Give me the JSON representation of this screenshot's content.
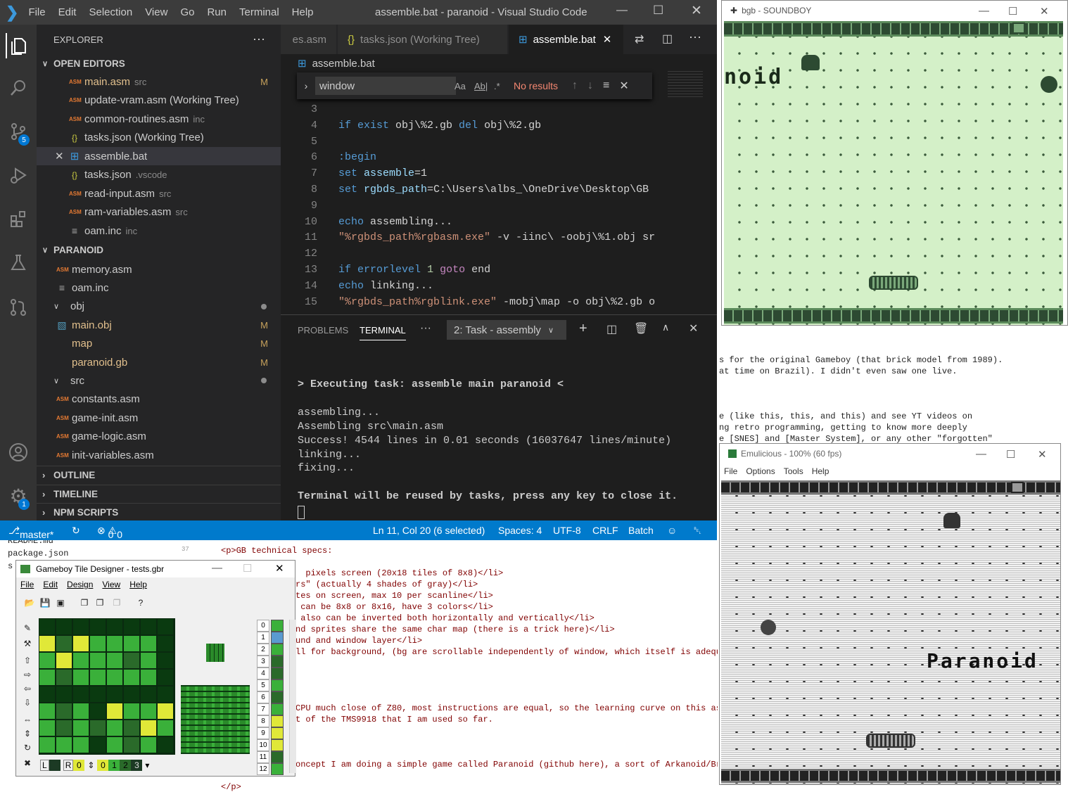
{
  "vscode": {
    "window_title": "assemble.bat - paranoid - Visual Studio Code",
    "menu": [
      "File",
      "Edit",
      "Selection",
      "View",
      "Go",
      "Run",
      "Terminal",
      "Help"
    ],
    "activity_badges": {
      "scm": "5",
      "settings": "1"
    },
    "explorer_title": "EXPLORER",
    "open_editors_label": "OPEN EDITORS",
    "open_editors": [
      {
        "name": "main.asm",
        "desc": "src",
        "flag": "M"
      },
      {
        "name": "update-vram.asm (Working Tree)",
        "desc": "",
        "flag": ""
      },
      {
        "name": "common-routines.asm",
        "desc": "inc",
        "flag": ""
      },
      {
        "name": "tasks.json (Working Tree)",
        "desc": "",
        "flag": ""
      },
      {
        "name": "assemble.bat",
        "desc": "",
        "flag": ""
      },
      {
        "name": "tasks.json",
        "desc": ".vscode",
        "flag": ""
      },
      {
        "name": "read-input.asm",
        "desc": "src",
        "flag": ""
      },
      {
        "name": "ram-variables.asm",
        "desc": "src",
        "flag": ""
      },
      {
        "name": "oam.inc",
        "desc": "inc",
        "flag": ""
      }
    ],
    "project_label": "PARANOID",
    "tree": [
      {
        "name": "memory.asm",
        "flag": ""
      },
      {
        "name": "oam.inc",
        "flag": ""
      },
      {
        "name": "obj",
        "flag": ""
      },
      {
        "name": "main.obj",
        "flag": "M"
      },
      {
        "name": "map",
        "flag": "M"
      },
      {
        "name": "paranoid.gb",
        "flag": "M"
      },
      {
        "name": "src",
        "flag": ""
      },
      {
        "name": "constants.asm",
        "flag": ""
      },
      {
        "name": "game-init.asm",
        "flag": ""
      },
      {
        "name": "game-logic.asm",
        "flag": ""
      },
      {
        "name": "init-variables.asm",
        "flag": ""
      }
    ],
    "outline_label": "OUTLINE",
    "timeline_label": "TIMELINE",
    "npm_label": "NPM SCRIPTS",
    "tabs": [
      "es.asm",
      "tasks.json (Working Tree)",
      "assemble.bat"
    ],
    "breadcrumb": "assemble.bat",
    "find": {
      "value": "window",
      "aa": "Aa",
      "ab": "Ab|",
      "re": ".*",
      "result": "No results"
    },
    "code_lines": [
      {
        "n": "3",
        "t": ""
      },
      {
        "n": "4",
        "t": "if exist obj\\%2.gb del obj\\%2.gb"
      },
      {
        "n": "5",
        "t": ""
      },
      {
        "n": "6",
        "t": ":begin"
      },
      {
        "n": "7",
        "t": "set assemble=1"
      },
      {
        "n": "8",
        "t": "set rgbds_path=C:\\Users\\albs_\\OneDrive\\Desktop\\GB"
      },
      {
        "n": "9",
        "t": ""
      },
      {
        "n": "10",
        "t": "echo assembling..."
      },
      {
        "n": "11",
        "t": "\"%rgbds_path%rgbasm.exe\" -v -iinc\\ -oobj\\%1.obj sr"
      },
      {
        "n": "12",
        "t": ""
      },
      {
        "n": "13",
        "t": "if errorlevel 1 goto end"
      },
      {
        "n": "14",
        "t": "echo linking..."
      },
      {
        "n": "15",
        "t": "\"%rgbds_path%rgblink.exe\" -mobj\\map -o obj\\%2.gb o"
      }
    ],
    "panel_tabs": [
      "PROBLEMS",
      "TERMINAL",
      "···"
    ],
    "task_select": "2: Task - assembly",
    "terminal_lines": [
      "> Executing task: assemble main paranoid <",
      "",
      "assembling...",
      "Assembling src\\main.asm",
      "Success! 4544 lines in 0.01 seconds (16037647 lines/minute)",
      "linking...",
      "fixing...",
      "",
      "Terminal will be reused by tasks, press any key to close it."
    ],
    "status": {
      "branch": "master*",
      "errors": "0",
      "warnings": "0",
      "position": "Ln 11, Col 20 (6 selected)",
      "spaces": "Spaces: 4",
      "encoding": "UTF-8",
      "eol": "CRLF",
      "lang": "Batch"
    }
  },
  "bgb": {
    "title": "bgb - SOUNDBOY",
    "game_text": "noid"
  },
  "emulicious": {
    "title": "Emulicious - 100% (60 fps)",
    "menu": [
      "File",
      "Options",
      "Tools",
      "Help"
    ],
    "game_text": "Paranoid"
  },
  "gbtd": {
    "title": "Gameboy Tile Designer - tests.gbr",
    "menu": [
      "File",
      "Edit",
      "Design",
      "View",
      "Help"
    ],
    "l_label": "L",
    "r_label": "R",
    "r_value": "0",
    "palette": [
      "0",
      "1",
      "2",
      "3"
    ],
    "tile_numbers": [
      "0",
      "1",
      "2",
      "3",
      "4",
      "5",
      "6",
      "7",
      "8",
      "9",
      "10",
      "11",
      "12"
    ]
  },
  "background_page": {
    "right_lines": [
      "s for the original Gameboy (that brick model from 1989).",
      "at time on Brazil). I didn't even saw one live.",
      "",
      "",
      "",
      "e (like this, this, and this) and see YT videos on",
      "ng retro programming, getting to know more deeply",
      "e [SNES] and [Master System], or any other \"forgotten\""
    ],
    "left_files": [
      "README.md",
      "package.json",
      "s"
    ],
    "line_number": "37",
    "html_lines": [
      "<p>GB technical specs:",
      "",
      "  pixels screen (20x18 tiles of 8x8)</li>",
      "rs\" (actually 4 shades of gray)</li>",
      "tes on screen, max 10 per scanline</li>",
      " can be 8x8 or 8x16, have 3 colors</li>",
      " also can be inverted both horizontally and vertically</li>",
      "nd sprites share the same char map (there is a trick here)</li>",
      "und and window layer</li>",
      "ll for background, (bg are scrollable independently of window, which itself is adequ",
      "",
      "",
      "",
      "",
      "CPU much close of Z80, most instructions are equal, so the learning curve on this asp",
      "t of the TMS9918 that I am used so far.",
      "",
      "",
      "",
      "oncept I am doing a simple game called Paranoid (github here), a sort of Arkanoid/Br",
      "",
      "</p>"
    ]
  }
}
